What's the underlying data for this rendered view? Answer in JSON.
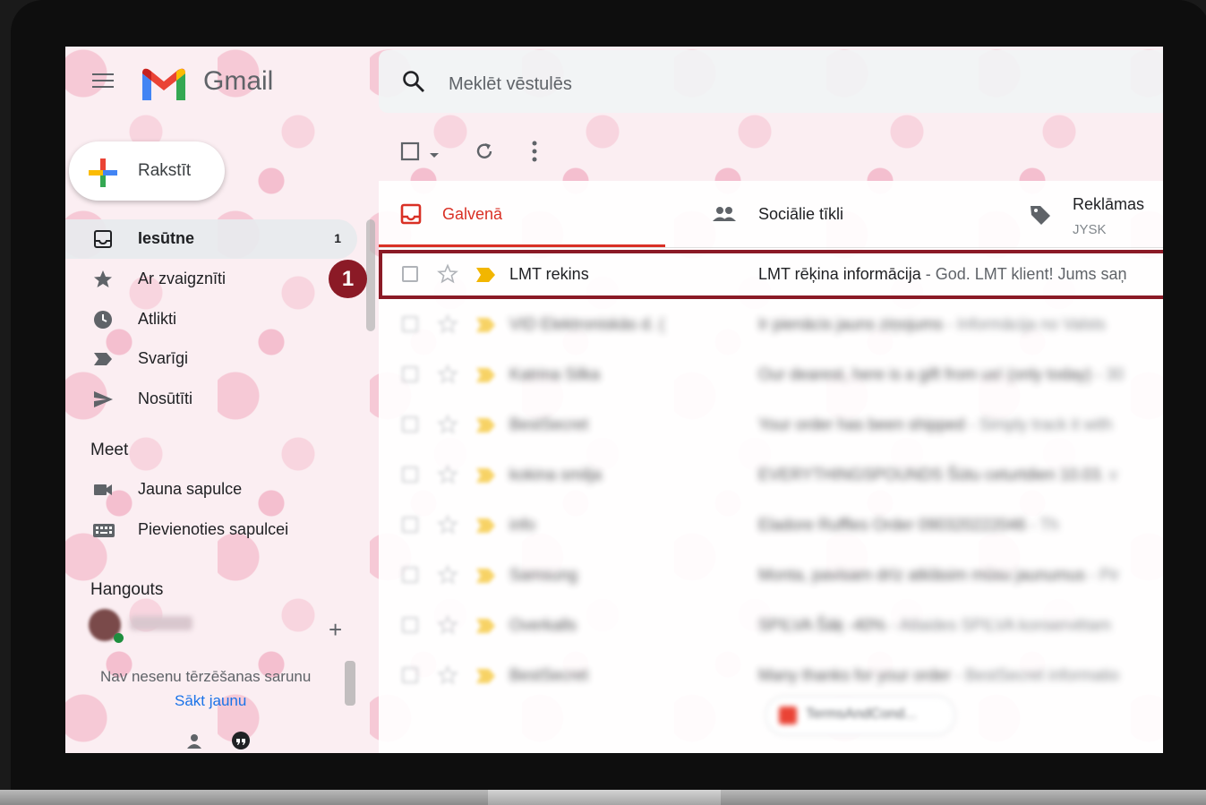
{
  "app": {
    "name": "Gmail"
  },
  "compose": {
    "label": "Rakstīt"
  },
  "nav": [
    {
      "label": "Iesūtne",
      "icon": "inbox-icon",
      "count": "1",
      "active": true
    },
    {
      "label": "Ar zvaigznīti",
      "icon": "star-icon"
    },
    {
      "label": "Atlikti",
      "icon": "clock-icon"
    },
    {
      "label": "Svarīgi",
      "icon": "important-icon"
    },
    {
      "label": "Nosūtīti",
      "icon": "send-icon"
    }
  ],
  "meet": {
    "heading": "Meet",
    "items": [
      {
        "label": "Jauna sapulce",
        "icon": "video-icon"
      },
      {
        "label": "Pievienoties sapulcei",
        "icon": "keyboard-icon"
      }
    ]
  },
  "hangouts": {
    "heading": "Hangouts",
    "no_chats": "Nav nesenu tērzēšanas sarunu",
    "start_new": "Sākt jaunu"
  },
  "search": {
    "placeholder": "Meklēt vēstulēs"
  },
  "tabs": [
    {
      "label": "Galvenā",
      "icon": "inbox-tab-icon"
    },
    {
      "label": "Sociālie tīkli",
      "icon": "people-icon"
    },
    {
      "label": "Reklāmas",
      "sub": "JYSK",
      "icon": "tag-icon"
    }
  ],
  "emails": [
    {
      "sender": "LMT rekins",
      "subject": "LMT rēķina informācija",
      "snippet": " - God. LMT klient! Jums saņ",
      "highlighted": true
    },
    {
      "sender": "VID Elektroniskās d. (",
      "subject": "Ir pienācis jauns ziņojums",
      "snippet": " - Informācija no Valsts",
      "blurred": true
    },
    {
      "sender": "Katrina Silka",
      "subject": "Our dearest, here is a gift from us! (only today)",
      "snippet": " - 30",
      "blurred": true
    },
    {
      "sender": "BestSecret",
      "subject": "Your order has been shipped",
      "snippet": " - Simply track it with",
      "blurred": true
    },
    {
      "sender": "kokina smilja",
      "subject": "EVERYTHINGSPOUNDS Šūtu ceturtdien 10.03.",
      "snippet": " v",
      "blurred": true
    },
    {
      "sender": "info",
      "subject": "Eladore Ruffles Order 090320222046",
      "snippet": " - Th",
      "blurred": true
    },
    {
      "sender": "Samsung",
      "subject": "Monta, pavisam drīz atklāsim mūsu jaunumus",
      "snippet": " - Pir",
      "blurred": true
    },
    {
      "sender": "Overkalls",
      "subject": "SPILVA Šāķ -40%",
      "snippet": " - Atlaides SPILVA konservētam",
      "blurred": true
    },
    {
      "sender": "BestSecret",
      "subject": "Many thanks for your order",
      "snippet": " - BestSecret informatio",
      "blurred": true,
      "attachment": "TermsAndCond..."
    }
  ],
  "annotation": {
    "step": "1"
  },
  "colors": {
    "accent": "#d93025",
    "highlight": "#8b1a26",
    "link": "#1a73e8"
  }
}
